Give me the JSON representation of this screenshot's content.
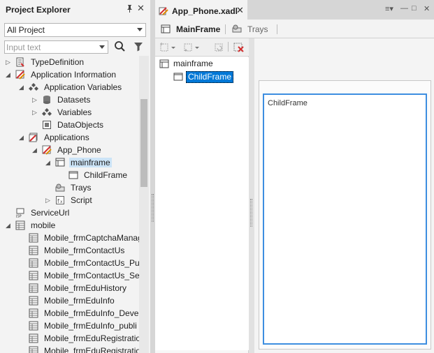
{
  "explorer": {
    "title": "Project Explorer",
    "pin_glyph": "❁",
    "close_glyph": "✕",
    "scope_value": "All Project",
    "search_placeholder": "Input text",
    "tree": [
      {
        "label": "TypeDefinition",
        "icon": "type-definition-icon",
        "expander": "▷",
        "level": 0
      },
      {
        "label": "Application Information",
        "icon": "application-info-icon",
        "expander": "◢",
        "level": 0
      },
      {
        "label": "Application Variables",
        "icon": "variables-icon",
        "expander": "◢",
        "level": 1
      },
      {
        "label": "Datasets",
        "icon": "database-icon",
        "expander": "▷",
        "level": 2
      },
      {
        "label": "Variables",
        "icon": "variables-icon",
        "expander": "▷",
        "level": 2
      },
      {
        "label": "DataObjects",
        "icon": "data-object-icon",
        "expander": "",
        "level": 2
      },
      {
        "label": "Applications",
        "icon": "applications-icon",
        "expander": "◢",
        "level": 1
      },
      {
        "label": "App_Phone",
        "icon": "app-icon",
        "expander": "◢",
        "level": 2
      },
      {
        "label": "mainframe",
        "icon": "mainframe-icon",
        "expander": "◢",
        "level": 3,
        "selected": true
      },
      {
        "label": "ChildFrame",
        "icon": "childframe-icon",
        "expander": "",
        "level": 4
      },
      {
        "label": "Trays",
        "icon": "trays-icon",
        "expander": "",
        "level": 3
      },
      {
        "label": "Script",
        "icon": "script-icon",
        "expander": "▷",
        "level": 3
      },
      {
        "label": "ServiceUrl",
        "icon": "service-url-icon",
        "expander": "",
        "level": 0
      },
      {
        "label": "mobile",
        "icon": "form-group-icon",
        "expander": "◢",
        "level": 0
      },
      {
        "label": "Mobile_frmCaptchaManage",
        "icon": "form-icon",
        "expander": "",
        "level": 1
      },
      {
        "label": "Mobile_frmContactUs",
        "icon": "form-icon",
        "expander": "",
        "level": 1
      },
      {
        "label": "Mobile_frmContactUs_Pub",
        "icon": "form-icon",
        "expander": "",
        "level": 1
      },
      {
        "label": "Mobile_frmContactUs_Sea",
        "icon": "form-icon",
        "expander": "",
        "level": 1
      },
      {
        "label": "Mobile_frmEduHistory",
        "icon": "form-icon",
        "expander": "",
        "level": 1
      },
      {
        "label": "Mobile_frmEduInfo",
        "icon": "form-icon",
        "expander": "",
        "level": 1
      },
      {
        "label": "Mobile_frmEduInfo_Devel",
        "icon": "form-icon",
        "expander": "",
        "level": 1
      },
      {
        "label": "Mobile_frmEduInfo_publi",
        "icon": "form-icon",
        "expander": "",
        "level": 1
      },
      {
        "label": "Mobile_frmEduRegistratio",
        "icon": "form-icon",
        "expander": "",
        "level": 1
      },
      {
        "label": "Mobile_frmEduRegistratio",
        "icon": "form-icon",
        "expander": "",
        "level": 1
      }
    ]
  },
  "document": {
    "tab_label": "App_Phone.xadl",
    "tab_close": "✕",
    "window_tools": [
      "≡▾",
      "—",
      "□",
      "✕"
    ],
    "subtabs": [
      {
        "label": "MainFrame",
        "icon": "mainframe-icon",
        "active": true
      },
      {
        "label": "Trays",
        "icon": "trays-icon",
        "active": false
      }
    ],
    "structure": [
      {
        "label": "mainframe",
        "icon": "mainframe-icon",
        "level": 0
      },
      {
        "label": "ChildFrame",
        "icon": "childframe-icon",
        "level": 1,
        "selected": true
      }
    ],
    "canvas_frame_label": "ChildFrame"
  },
  "colors": {
    "accent": "#0078d7",
    "selection_light": "#cce4f7",
    "frame_border": "#3d8ee0",
    "close_red": "#d32f2f"
  }
}
